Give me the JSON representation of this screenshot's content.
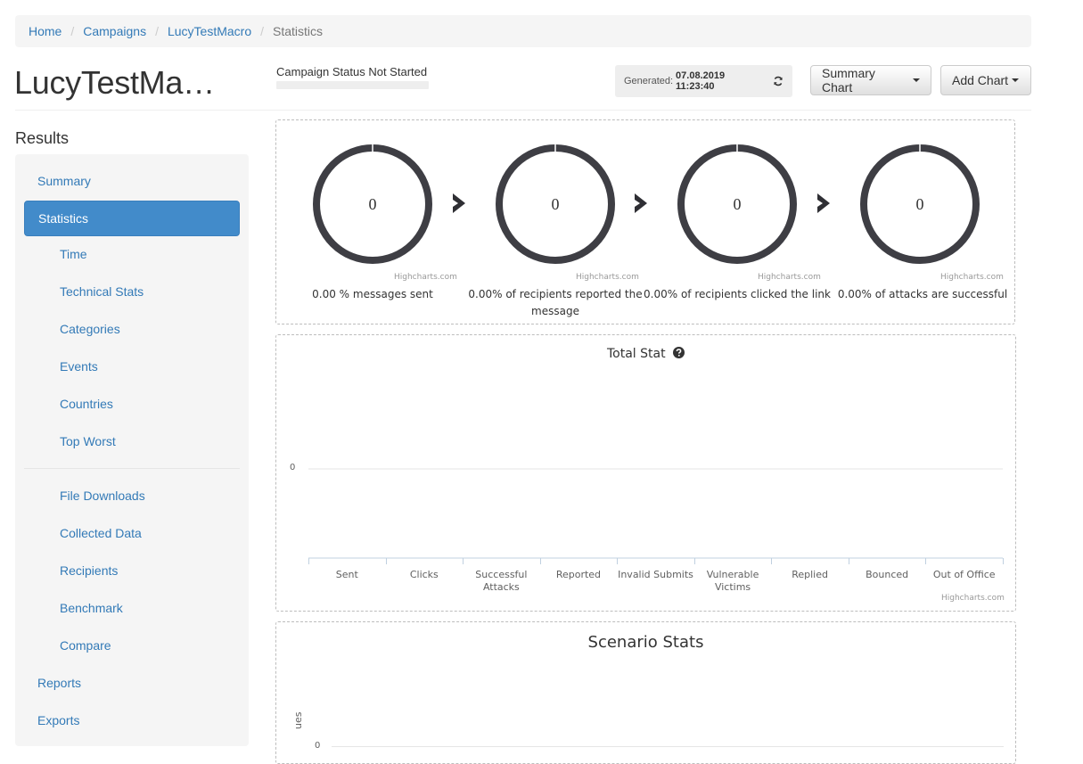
{
  "breadcrumb": {
    "items": [
      "Home",
      "Campaigns",
      "LucyTestMacro"
    ],
    "active": "Statistics"
  },
  "page": {
    "title": "LucyTestMa…",
    "campaign_status": "Campaign Status Not Started"
  },
  "toolbar": {
    "generated_label": "Generated:",
    "generated_value": "07.08.2019 11:23:40",
    "summary_chart_label": "Summary Chart",
    "add_chart_label": "Add Chart"
  },
  "sidebar": {
    "heading": "Results",
    "items": [
      {
        "label": "Summary",
        "level": "top",
        "active": false
      },
      {
        "label": "Statistics",
        "level": "top",
        "active": true
      },
      {
        "label": "Time",
        "level": "sub",
        "active": false
      },
      {
        "label": "Technical Stats",
        "level": "sub",
        "active": false
      },
      {
        "label": "Categories",
        "level": "sub",
        "active": false
      },
      {
        "label": "Events",
        "level": "sub",
        "active": false
      },
      {
        "label": "Countries",
        "level": "sub",
        "active": false
      },
      {
        "label": "Top Worst",
        "level": "sub",
        "active": false
      },
      {
        "label": "File Downloads",
        "level": "sub",
        "active": false
      },
      {
        "label": "Collected Data",
        "level": "sub",
        "active": false
      },
      {
        "label": "Recipients",
        "level": "sub",
        "active": false
      },
      {
        "label": "Benchmark",
        "level": "sub",
        "active": false
      },
      {
        "label": "Compare",
        "level": "sub",
        "active": false
      },
      {
        "label": "Reports",
        "level": "top",
        "active": false
      },
      {
        "label": "Exports",
        "level": "top",
        "active": false
      }
    ]
  },
  "funnel": {
    "credit": "Highcharts.com",
    "donuts": [
      {
        "value": "0",
        "label": "0.00 % messages sent"
      },
      {
        "value": "0",
        "label": "0.00% of recipients reported the message"
      },
      {
        "value": "0",
        "label": "0.00% of recipients clicked the link"
      },
      {
        "value": "0",
        "label": "0.00% of attacks are successful"
      }
    ]
  },
  "total_stat": {
    "credit": "Highcharts.com",
    "zero_tick": "0"
  },
  "scenario_stats": {
    "zero_tick": "0",
    "ylabel_fragment": "ues"
  },
  "chart_data": [
    {
      "type": "bar",
      "title": "Total Stat",
      "categories": [
        "Sent",
        "Clicks",
        "Successful Attacks",
        "Reported",
        "Invalid Submits",
        "Vulnerable Victims",
        "Replied",
        "Bounced",
        "Out of Office"
      ],
      "values": [
        0,
        0,
        0,
        0,
        0,
        0,
        0,
        0,
        0
      ],
      "y_ticks": [
        "0"
      ],
      "xlabel": "",
      "ylabel": "",
      "grid": true
    },
    {
      "type": "bar",
      "title": "Scenario Stats",
      "categories": [],
      "values": [],
      "y_ticks": [
        "0"
      ],
      "xlabel": "",
      "ylabel": "ues",
      "grid": true
    }
  ]
}
